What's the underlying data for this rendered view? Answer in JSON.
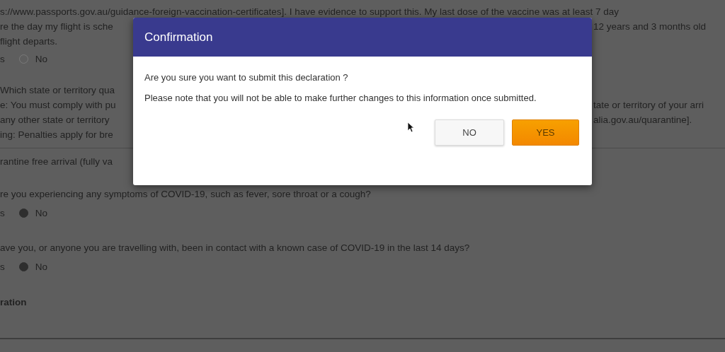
{
  "background_form": {
    "lines": [
      {
        "kind": "wide",
        "left": "s://www.passports.gov.au/guidance-foreign-vaccination-certificates]. I have evidence to support this. My last dose of the vaccine was at least 7 day"
      },
      {
        "kind": "text",
        "left": "re the day my flight is sche",
        "right": "12 years and 3 months old"
      },
      {
        "kind": "text",
        "left": "flight departs."
      },
      {
        "kind": "radio",
        "left": "s",
        "option": "No",
        "selected": false
      },
      {
        "kind": "text",
        "left": "Which state or territory qua"
      },
      {
        "kind": "text",
        "left": "e: You must comply with pu",
        "right": "tate or territory of your arri"
      },
      {
        "kind": "text",
        "left": "any other state or territory",
        "right": "alia.gov.au/quarantine]."
      },
      {
        "kind": "text",
        "left": "ing: Penalties apply for bre"
      },
      {
        "kind": "rule"
      },
      {
        "kind": "text",
        "left": "rantine free arrival (fully va"
      },
      {
        "kind": "question",
        "left": "re you experiencing any symptoms of COVID-19, such as fever, sore throat or a cough?"
      },
      {
        "kind": "radio",
        "left": "s",
        "option": "No",
        "selected": true
      },
      {
        "kind": "question",
        "left": "ave you, or anyone you are travelling with, been in contact with a known case of COVID-19 in the last 14 days?"
      },
      {
        "kind": "radio",
        "left": "s",
        "option": "No",
        "selected": true
      },
      {
        "kind": "heading",
        "left": "ration"
      }
    ]
  },
  "dialog": {
    "title": "Confirmation",
    "question": "Are you sure you want to submit this declaration ?",
    "note": "Please note that you will not be able to make further changes to this information once submitted.",
    "buttons": [
      {
        "label": "NO",
        "kind": "secondary"
      },
      {
        "label": "YES",
        "kind": "primary"
      }
    ]
  }
}
